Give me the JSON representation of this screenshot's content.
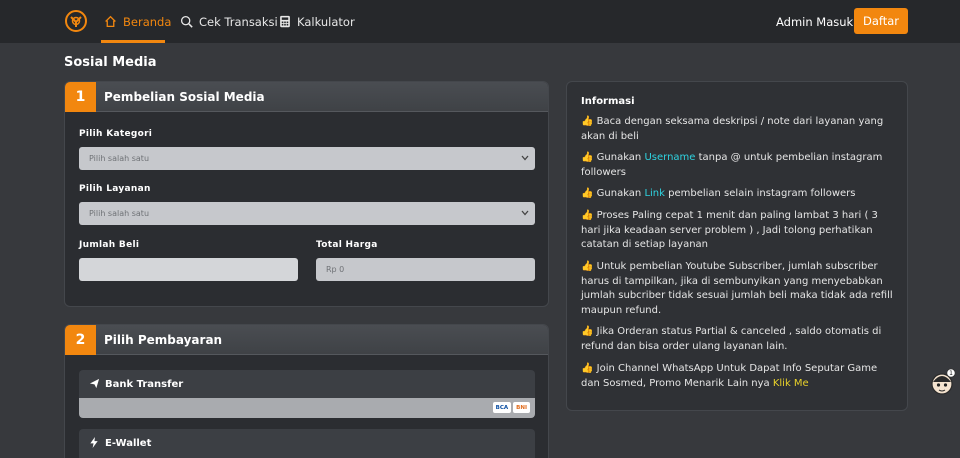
{
  "nav": {
    "items": [
      {
        "label": "Beranda",
        "icon": "home-icon",
        "active": true
      },
      {
        "label": "Cek Transaksi",
        "icon": "search-icon",
        "active": false
      },
      {
        "label": "Kalkulator",
        "icon": "calculator-icon",
        "active": false
      }
    ],
    "admin_label": "Admin Masuk",
    "register_label": "Daftar",
    "accent": "#f2870f"
  },
  "page_title": "Sosial Media",
  "purchase_card": {
    "step": "1",
    "title": "Pembelian Sosial Media",
    "category_label": "Pilih Kategori",
    "category_value": "Pilih salah satu",
    "service_label": "Pilih Layanan",
    "service_value": "Pilih salah satu",
    "qty_label": "Jumlah Beli",
    "qty_value": "",
    "total_label": "Total Harga",
    "total_placeholder": "Rp 0"
  },
  "payment_card": {
    "step": "2",
    "title": "Pilih Pembayaran",
    "methods": [
      {
        "label": "Bank Transfer",
        "icon": "paper-plane-icon",
        "badges": [
          "BCA",
          "BNI"
        ]
      },
      {
        "label": "E-Wallet",
        "icon": "lightning-icon"
      }
    ]
  },
  "info": {
    "title": "Informasi",
    "items": [
      {
        "text": "Baca dengan seksama deskripsi / note dari layanan yang akan di beli"
      },
      {
        "pre": "Gunakan ",
        "highlight": "Username",
        "post": " tanpa @ untuk pembelian instagram followers"
      },
      {
        "pre": "Gunakan ",
        "highlight": "Link",
        "post": " pembelian selain instagram followers"
      },
      {
        "text": "Proses Paling cepat 1 menit dan paling lambat 3 hari ( 3 hari jika keadaan server problem ) , Jadi tolong perhatikan catatan di setiap layanan"
      },
      {
        "text": "Untuk pembelian Youtube Subscriber, jumlah subscriber harus di tampilkan, jika di sembunyikan yang menyebabkan jumlah subcriber tidak sesuai jumlah beli maka tidak ada refill maupun refund."
      },
      {
        "text": "Jika Orderan status Partial & canceled , saldo otomatis di refund dan bisa order ulang layanan lain."
      },
      {
        "pre": "Join Channel WhatsApp Untuk Dapat Info Seputar Game dan Sosmed, Promo Menarik Lain nya ",
        "highlight": "Klik Me",
        "post": ""
      }
    ]
  }
}
